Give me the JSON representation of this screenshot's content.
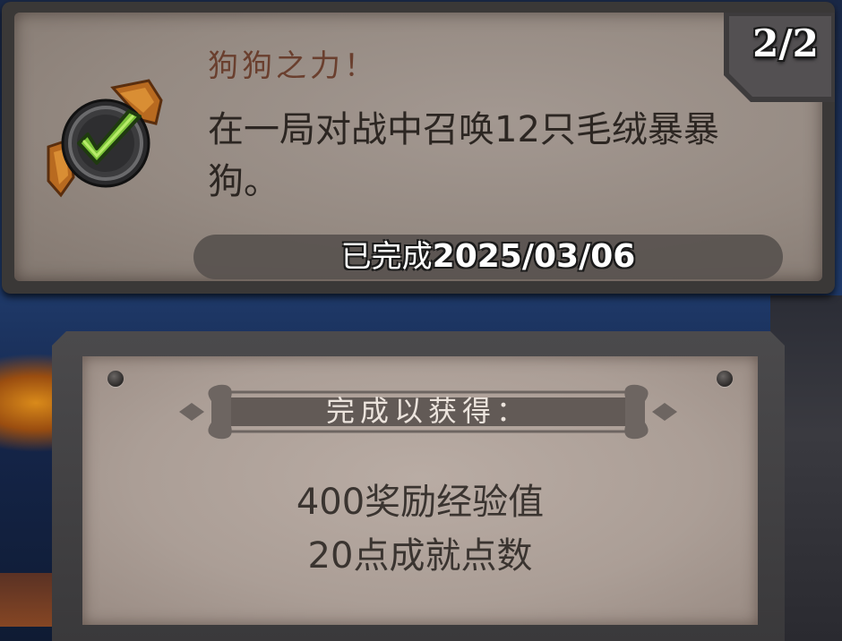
{
  "quest": {
    "title": "狗狗之力！",
    "description": "在一局对战中召唤12只毛绒暴暴狗。",
    "progress": "2/2",
    "completed_label": "已完成",
    "completed_date": "2025/03/06",
    "status_icon": "checkmark-icon"
  },
  "reward": {
    "header": "完成以获得：",
    "items": [
      {
        "text": "400奖励经验值"
      },
      {
        "text": "20点成就点数"
      }
    ]
  },
  "colors": {
    "parchment": "#958a82",
    "frame": "#3a3837",
    "check_green": "#7cc33a",
    "title_brown": "#6a3f2e"
  }
}
